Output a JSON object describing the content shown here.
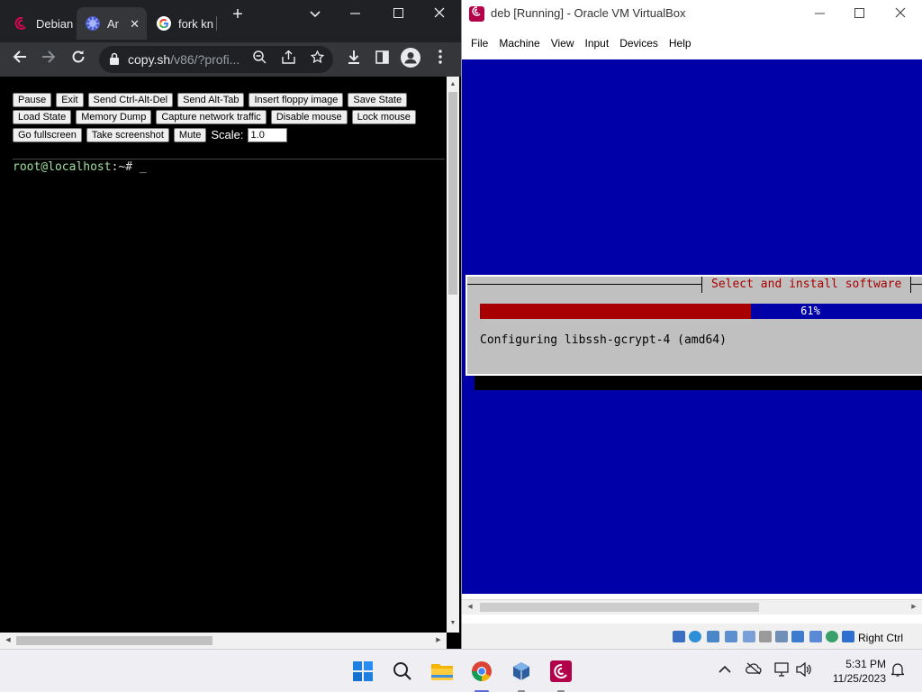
{
  "chrome": {
    "tabs": [
      {
        "label": "Debian",
        "favicon": "debian-swirl-icon"
      },
      {
        "label": "Ar",
        "favicon": "v86-icon"
      },
      {
        "label": "fork kn",
        "favicon": "google-icon"
      }
    ],
    "new_tab": "+",
    "url_host": "copy.sh",
    "url_path": "/v86/?profi..."
  },
  "v86": {
    "row1": [
      "Pause",
      "Exit",
      "Send Ctrl-Alt-Del",
      "Send Alt-Tab",
      "Insert floppy image",
      "Save State"
    ],
    "row2": [
      "Load State",
      "Memory Dump",
      "Capture network traffic",
      "Disable mouse",
      "Lock mouse"
    ],
    "row3": [
      "Go fullscreen",
      "Take screenshot",
      "Mute"
    ],
    "scale_label": "Scale:",
    "scale_value": "1.0",
    "prompt_user": "root@localhost",
    "prompt_rest": ":~# _"
  },
  "vbox": {
    "title": "deb [Running] - Oracle VM VirtualBox",
    "menu": [
      "File",
      "Machine",
      "View",
      "Input",
      "Devices",
      "Help"
    ],
    "dialog_title": "Select and install software",
    "progress_percent": 61,
    "progress_label": "61%",
    "message": "Configuring libssh-gcrypt-4 (amd64)",
    "host_key": "Right Ctrl"
  },
  "taskbar": {
    "apps": [
      "windows-start-icon",
      "search-icon",
      "file-explorer-icon",
      "chrome-icon",
      "virtualbox-icon",
      "debian-icon"
    ],
    "time": "5:31 PM",
    "date": "11/25/2023"
  },
  "colors": {
    "debian_red": "#a80000",
    "debian_blue": "#0000a8",
    "dialog_gray": "#c0c0c0",
    "prompt_green": "#9fe09f"
  }
}
